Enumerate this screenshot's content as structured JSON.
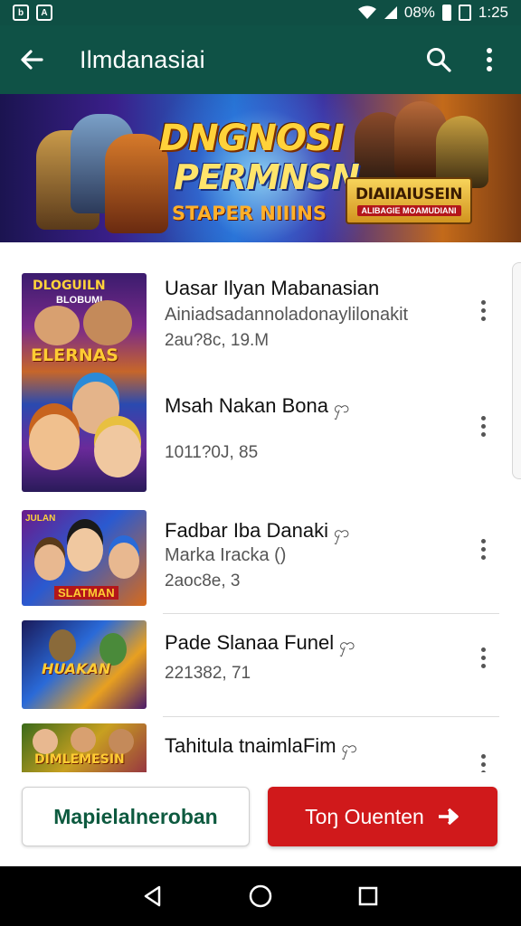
{
  "status_bar": {
    "battery_text": "08%",
    "time": "1:25"
  },
  "app_bar": {
    "title": "Ilmdanasiai",
    "icons": [
      "back-arrow-icon",
      "search-icon",
      "more-vert-icon"
    ]
  },
  "banner": {
    "title": "DNGNOSI",
    "subtitle": "PERMNSN",
    "tag": "STAPER NIIINS",
    "badge_title": "DIAIIAIUSEIN",
    "badge_sub": "ALIBAGIE MOAMUDIANI"
  },
  "thumbs": {
    "t1_top": "DLOGUILN",
    "t1_sub": "BLOBUMI",
    "t1_label": "ELERNAS",
    "t2_label": "HUAKAN",
    "t3_top": "JULAN",
    "t3_label": "SLATMAN",
    "t4_label": "DIMLEMESIN"
  },
  "list": {
    "items": [
      {
        "title": "Uasar Ilyan Mabanasian",
        "desc": "Ainiadsadannoladonaylilonakit",
        "meta": "2au?8c, 19.M"
      },
      {
        "title": "Msah Nakan Bona",
        "glyph": "ႁာ",
        "meta": "1011?0J, 85"
      },
      {
        "title": "Fadbar Iba Danaki",
        "glyph": "ႁာ",
        "desc": "Marka Iracka ()",
        "meta": "2aoc8e, 3"
      },
      {
        "title": "Pade Slanaa Funel",
        "glyph": "ႁာ",
        "meta": "221382, 71"
      },
      {
        "title": "Tahitula tnaimlaFim",
        "glyph": "ႁာ"
      }
    ]
  },
  "buttons": {
    "secondary_label": "Mapielalneroban",
    "primary_label": "Toŋ Ouenten"
  },
  "colors": {
    "app_bar": "#0f5246",
    "primary_button": "#d0191b",
    "secondary_text": "#0d5a3f"
  }
}
